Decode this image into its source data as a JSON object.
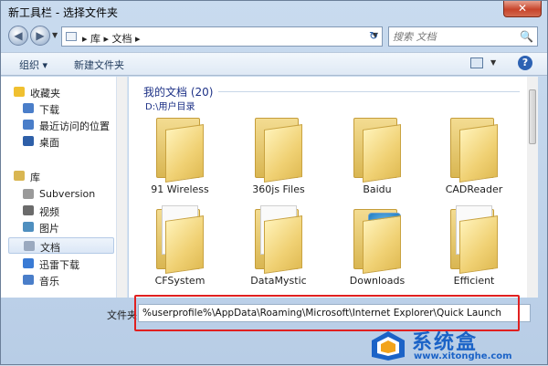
{
  "window": {
    "title": "新工具栏 - 选择文件夹",
    "close_label": "✕"
  },
  "nav": {
    "back_glyph": "◀",
    "forward_glyph": "▶",
    "breadcrumb": "▸ 库 ▸ 文档 ▸",
    "refresh_glyph": "↻",
    "search_placeholder": "搜索 文档"
  },
  "toolbar": {
    "organize_label": "组织 ▾",
    "new_folder_label": "新建文件夹",
    "help_label": "?"
  },
  "sidebar": {
    "items": [
      {
        "label": "收藏夹",
        "icon": "star-icon",
        "color": "#f0c030"
      },
      {
        "label": "下载",
        "icon": "download-icon",
        "color": "#4a7ec9"
      },
      {
        "label": "最近访问的位置",
        "icon": "recent-places-icon",
        "color": "#4a7ec9"
      },
      {
        "label": "桌面",
        "icon": "desktop-icon",
        "color": "#2e5fa8"
      },
      {
        "label": "库",
        "icon": "library-icon",
        "color": "#d9b652"
      },
      {
        "label": "Subversion",
        "icon": "library-icon",
        "color": "#9a9a9a"
      },
      {
        "label": "视频",
        "icon": "video-icon",
        "color": "#6b6b6b"
      },
      {
        "label": "图片",
        "icon": "picture-icon",
        "color": "#4f8fbf"
      },
      {
        "label": "文档",
        "icon": "documents-icon",
        "color": "#9aa9bf"
      },
      {
        "label": "迅雷下载",
        "icon": "thunder-icon",
        "color": "#3a7bd5"
      },
      {
        "label": "音乐",
        "icon": "music-icon",
        "color": "#4a7ec9"
      }
    ]
  },
  "content": {
    "group_title": "我的文档 (20)",
    "group_path": "D:\\用户目录",
    "folders": [
      {
        "label": "91 Wireless",
        "style": "plain"
      },
      {
        "label": "360js Files",
        "style": "plain"
      },
      {
        "label": "Baidu",
        "style": "plain"
      },
      {
        "label": "CADReader",
        "style": "plain"
      },
      {
        "label": "CFSystem",
        "style": "paper"
      },
      {
        "label": "DataMystic",
        "style": "paper"
      },
      {
        "label": "Downloads",
        "style": "photo"
      },
      {
        "label": "Efficient",
        "style": "paper"
      }
    ]
  },
  "filename": {
    "label": "文件夹:",
    "value": "%userprofile%\\AppData\\Roaming\\Microsoft\\Internet Explorer\\Quick Launch"
  },
  "watermark": {
    "text": "系统盒",
    "url": "www.xitonghe.com"
  }
}
